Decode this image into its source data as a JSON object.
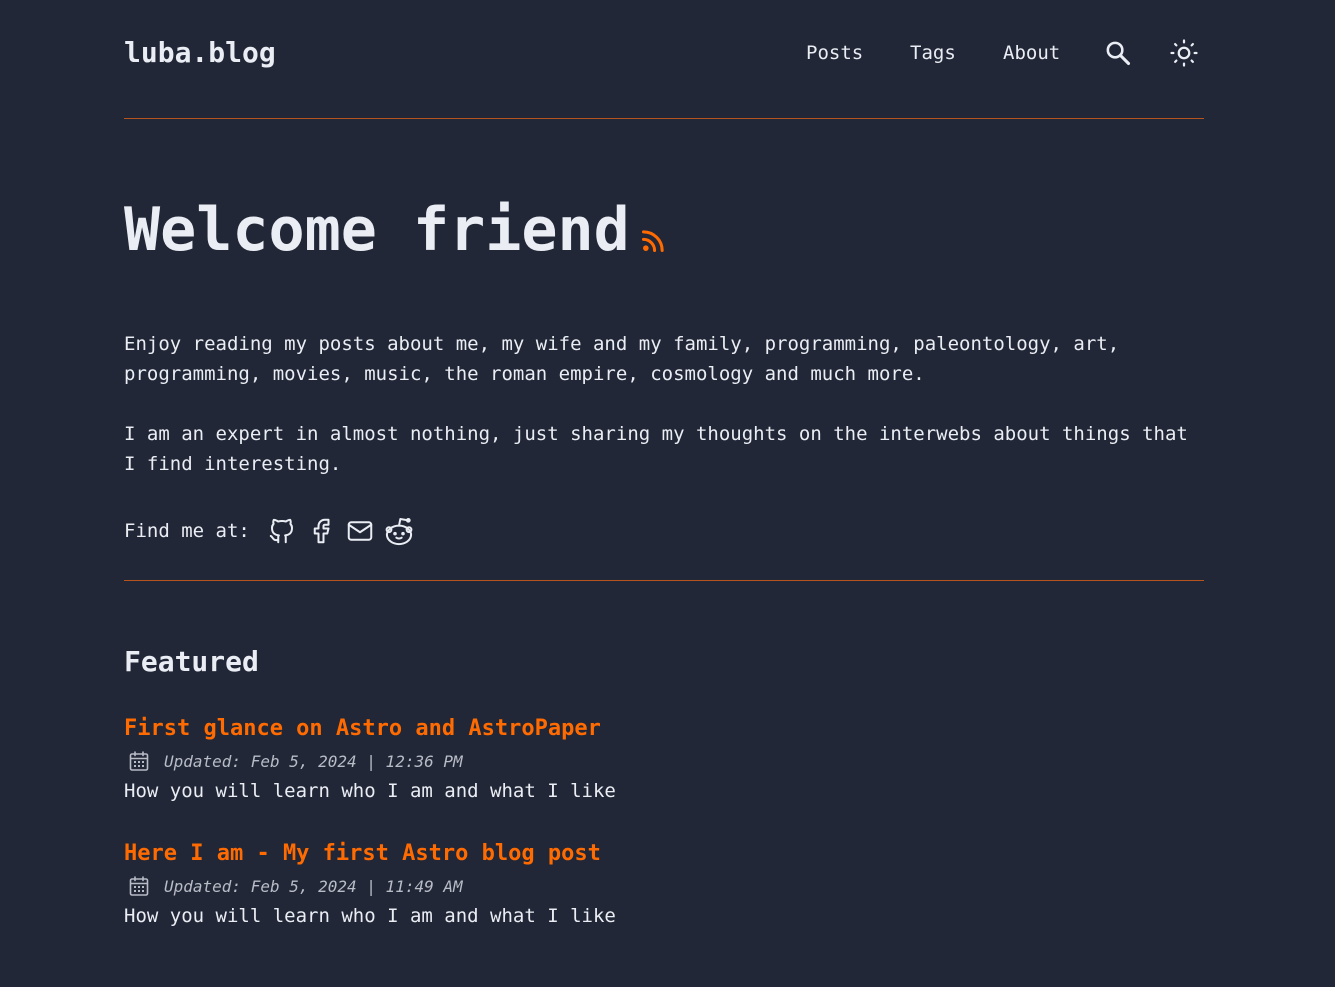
{
  "header": {
    "logo": "luba.blog",
    "nav": [
      {
        "label": "Posts"
      },
      {
        "label": "Tags"
      },
      {
        "label": "About"
      }
    ],
    "search_icon": "search-icon",
    "theme_icon": "sun-icon"
  },
  "hero": {
    "title": "Welcome friend",
    "rss_icon": "rss-icon",
    "paragraphs": [
      "Enjoy reading my posts about me, my wife and my family, programming, paleontology, art, programming, movies, music, the roman empire, cosmology and much more.",
      "I am an expert in almost nothing, just sharing my thoughts on the interwebs about things that I find interesting."
    ],
    "social_label": "Find me at:",
    "social_icons": [
      "github-icon",
      "facebook-icon",
      "mail-icon",
      "reddit-icon"
    ]
  },
  "featured": {
    "title": "Featured",
    "posts": [
      {
        "title": "First glance on Astro and AstroPaper",
        "date": "Updated: Feb 5, 2024 | 12:36 PM",
        "description": "How you will learn who I am and what I like"
      },
      {
        "title": "Here I am - My first Astro blog post",
        "date": "Updated: Feb 5, 2024 | 11:49 AM",
        "description": "How you will learn who I am and what I like"
      }
    ]
  },
  "colors": {
    "background": "#212737",
    "text": "#eaedf3",
    "accent": "#ff6b01",
    "divider": "#b5541c"
  }
}
